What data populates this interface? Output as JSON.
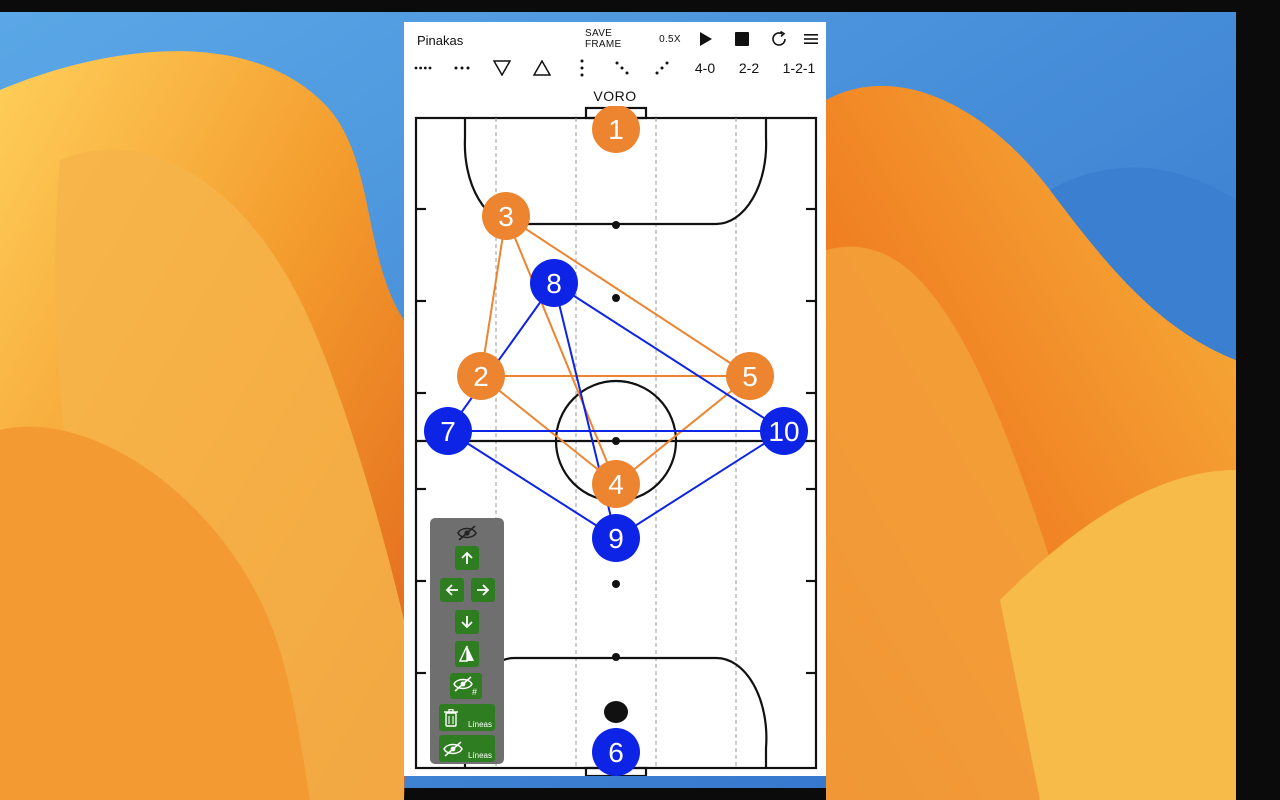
{
  "app": {
    "title": "Pinakas"
  },
  "toolbar": {
    "save_frame": "SAVE FRAME",
    "speed": "0.5X",
    "play_icon": "play-icon",
    "stop_icon": "stop-icon",
    "reset_icon": "reset-icon",
    "menu_icon": "menu-icon"
  },
  "formations": {
    "f1": "4-0",
    "f2": "2-2",
    "f3": "1-2-1"
  },
  "court": {
    "label": "VORO",
    "colors": {
      "orange": "#ec8430",
      "blue": "#0d23e6",
      "line": "#111111",
      "lane": "#999999"
    },
    "orange_players": [
      {
        "number": "1"
      },
      {
        "number": "3"
      },
      {
        "number": "2"
      },
      {
        "number": "5"
      },
      {
        "number": "4"
      }
    ],
    "blue_players": [
      {
        "number": "8"
      },
      {
        "number": "7"
      },
      {
        "number": "10"
      },
      {
        "number": "9"
      },
      {
        "number": "6"
      }
    ]
  },
  "panel": {
    "lines_label_1": "Líneas",
    "lines_label_2": "Líneas",
    "icons": [
      "eye-off-icon",
      "arrow-up-icon",
      "arrow-left-icon",
      "arrow-right-icon",
      "arrow-down-icon",
      "flip-icon",
      "eye-off-numbers-icon",
      "trash-icon",
      "eye-off-lines-icon"
    ]
  }
}
